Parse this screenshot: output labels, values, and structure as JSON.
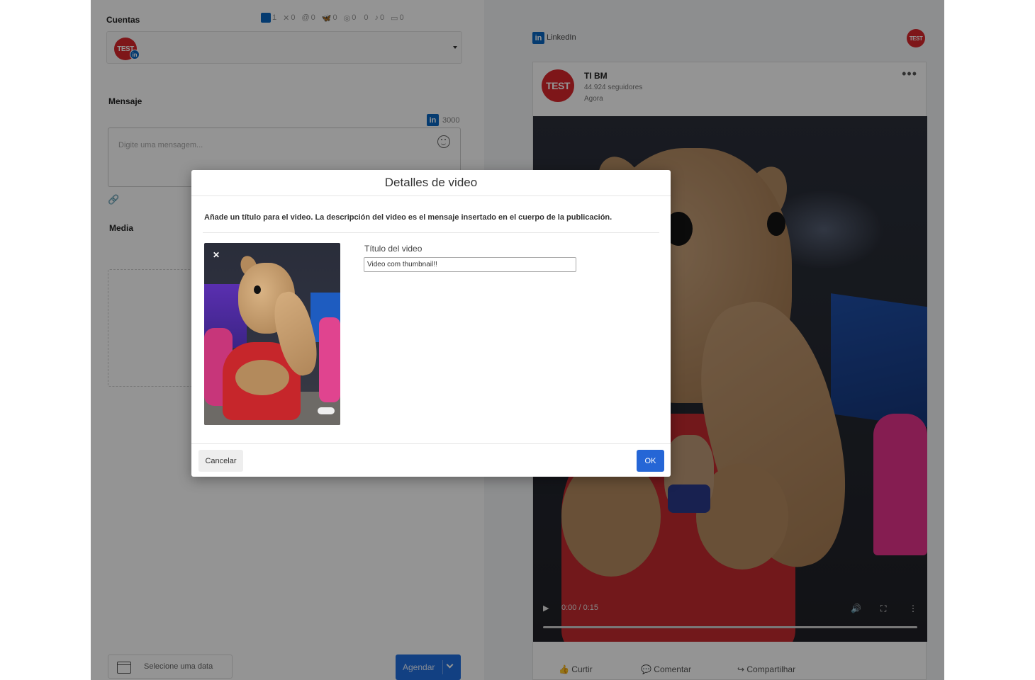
{
  "colors": {
    "linkedin": "#0a66c2",
    "primary_button": "#2566d6",
    "avatar_red": "#d9262c"
  },
  "composer": {
    "accounts_label": "Cuentas",
    "networks": [
      {
        "icon": "linkedin-icon",
        "count": "1"
      },
      {
        "icon": "x-icon",
        "count": "0"
      },
      {
        "icon": "threads-icon",
        "count": "0"
      },
      {
        "icon": "bluesky-icon",
        "count": "0"
      },
      {
        "icon": "instagram-icon",
        "count": "0"
      },
      {
        "icon": "facebook-icon",
        "count": "0"
      },
      {
        "icon": "tiktok-icon",
        "count": "0"
      },
      {
        "icon": "youtube-icon",
        "count": "0"
      }
    ],
    "avatar_text": "TEST",
    "message_label": "Mensaje",
    "char_limit": "3000",
    "message_placeholder": "Digite uma mensagem...",
    "media_label": "Media",
    "date_placeholder": "Selecione uma data",
    "schedule_button": "Agendar"
  },
  "preview": {
    "network_name": "LinkedIn",
    "avatar_text": "TEST",
    "page_name": "TI BM",
    "followers": "44.924 seguidores",
    "time": "Agora",
    "video_time": "0:00 / 0:15",
    "actions": [
      "Curtir",
      "Comentar",
      "Compartilhar"
    ]
  },
  "modal": {
    "title": "Detalles de video",
    "description": "Añade un título para el video. La descripción del video es el mensaje insertado en el cuerpo de la publicación.",
    "field_label": "Título del video",
    "field_value": "Video com thumbnail!!",
    "cancel_label": "Cancelar",
    "ok_label": "OK"
  }
}
